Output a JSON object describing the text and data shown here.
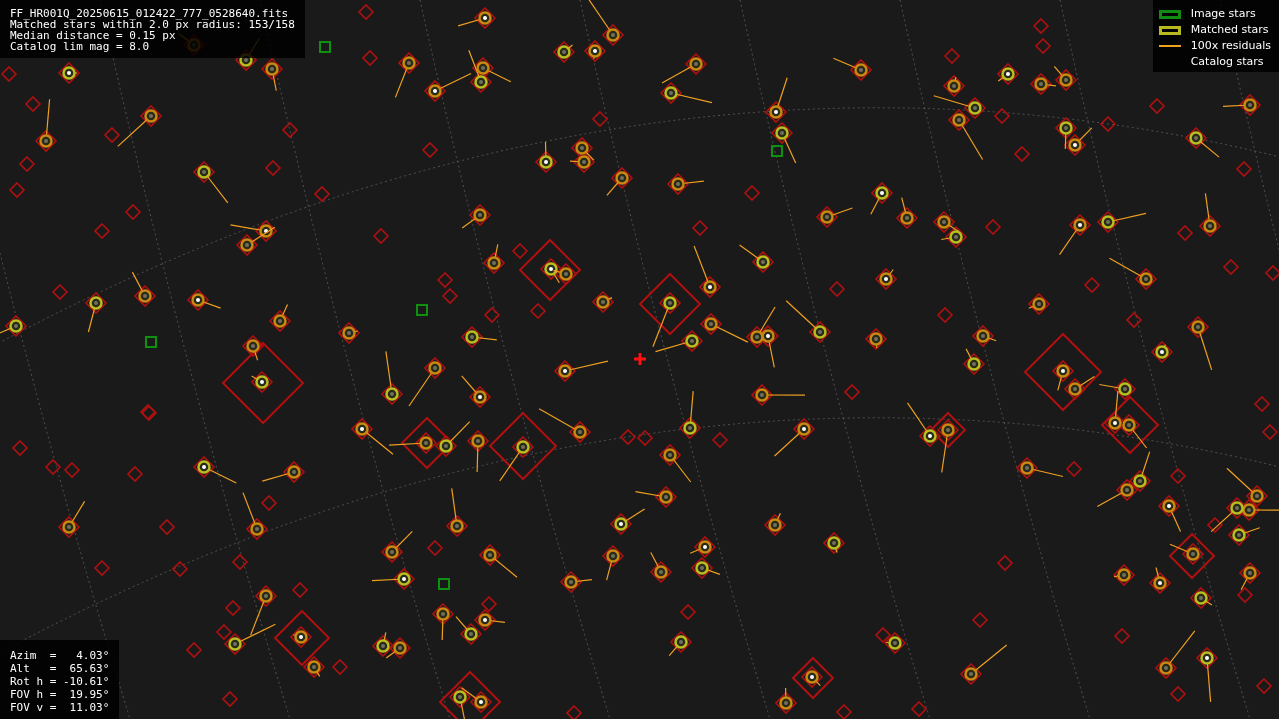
{
  "file_info": {
    "lines": [
      "FF_HR001Q_20250615_012422_777_0528640.fits",
      "Matched stars within 2.0 px radius: 153/158",
      "Median distance = 0.15 px",
      "Catalog lim mag = 8.0"
    ]
  },
  "legend": [
    {
      "label": "Image stars",
      "kind": "image"
    },
    {
      "label": "Matched stars",
      "kind": "matched"
    },
    {
      "label": "100x residuals",
      "kind": "residual"
    },
    {
      "label": "Catalog stars",
      "kind": "catalog"
    }
  ],
  "pointing_info": {
    "lines": [
      "Azim  =   4.03°",
      "Alt   =  65.63°",
      "Rot h = -10.61°",
      "FOV h =  19.95°",
      "FOV v =  11.03°"
    ]
  }
}
